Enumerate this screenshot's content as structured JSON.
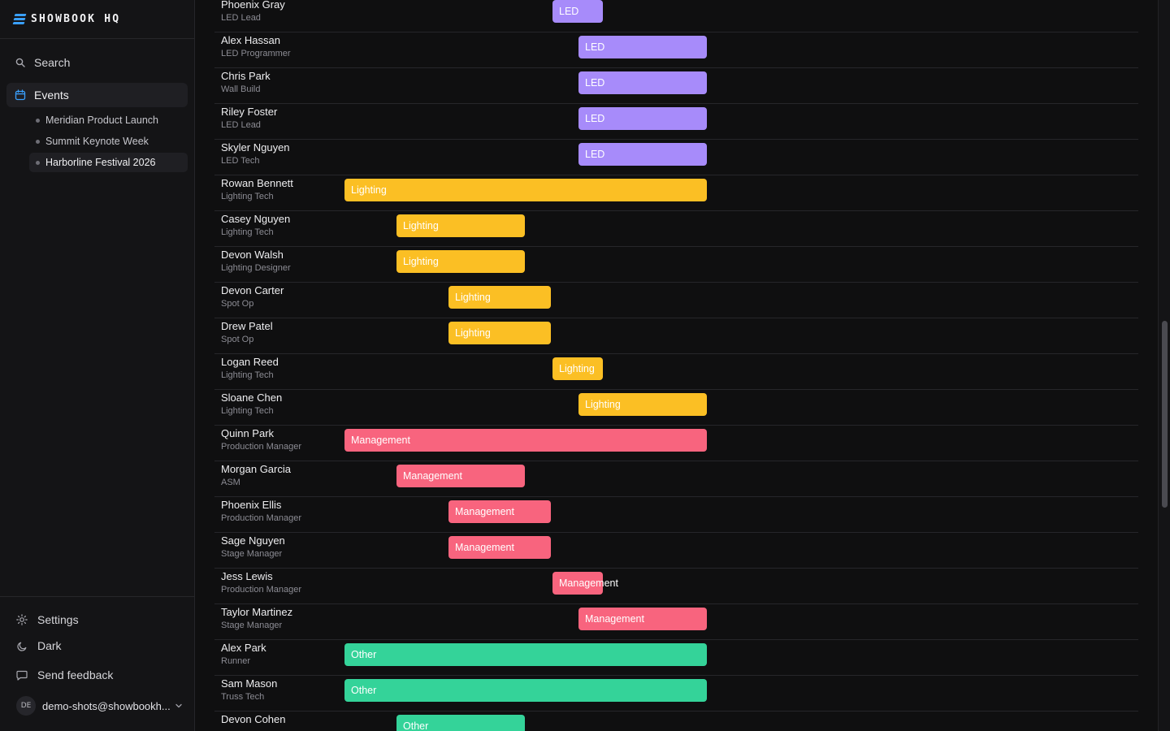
{
  "brand": {
    "name": "SHOWBOOK HQ"
  },
  "nav": {
    "search_label": "Search",
    "events_label": "Events",
    "events": [
      {
        "label": "Meridian Product Launch"
      },
      {
        "label": "Summit Keynote Week"
      },
      {
        "label": "Harborline Festival 2026"
      }
    ]
  },
  "bottom": {
    "settings_label": "Settings",
    "dark_label": "Dark",
    "feedback_label": "Send feedback",
    "user_initials": "DE",
    "user_email": "demo-shots@showbookh..."
  },
  "colors": {
    "LED": "#a78bfa",
    "Lighting": "#fbbf24",
    "Management": "#f8647e",
    "Other": "#34d399",
    "accent": "#3aa0ff"
  },
  "crew": [
    {
      "name": "Phoenix Gray",
      "role": "LED Lead",
      "dept": "LED",
      "start": 8,
      "span": 2
    },
    {
      "name": "Alex Hassan",
      "role": "LED Programmer",
      "dept": "LED",
      "start": 9,
      "span": 5
    },
    {
      "name": "Chris Park",
      "role": "Wall Build",
      "dept": "LED",
      "start": 9,
      "span": 5
    },
    {
      "name": "Riley Foster",
      "role": "LED Lead",
      "dept": "LED",
      "start": 9,
      "span": 5
    },
    {
      "name": "Skyler Nguyen",
      "role": "LED Tech",
      "dept": "LED",
      "start": 9,
      "span": 5
    },
    {
      "name": "Rowan Bennett",
      "role": "Lighting Tech",
      "dept": "Lighting",
      "start": 0,
      "span": 14
    },
    {
      "name": "Casey Nguyen",
      "role": "Lighting Tech",
      "dept": "Lighting",
      "start": 2,
      "span": 5
    },
    {
      "name": "Devon Walsh",
      "role": "Lighting Designer",
      "dept": "Lighting",
      "start": 2,
      "span": 5
    },
    {
      "name": "Devon Carter",
      "role": "Spot Op",
      "dept": "Lighting",
      "start": 4,
      "span": 4
    },
    {
      "name": "Drew Patel",
      "role": "Spot Op",
      "dept": "Lighting",
      "start": 4,
      "span": 4
    },
    {
      "name": "Logan Reed",
      "role": "Lighting Tech",
      "dept": "Lighting",
      "start": 8,
      "span": 2
    },
    {
      "name": "Sloane Chen",
      "role": "Lighting Tech",
      "dept": "Lighting",
      "start": 9,
      "span": 5
    },
    {
      "name": "Quinn Park",
      "role": "Production Manager",
      "dept": "Management",
      "start": 0,
      "span": 14
    },
    {
      "name": "Morgan Garcia",
      "role": "ASM",
      "dept": "Management",
      "start": 2,
      "span": 5
    },
    {
      "name": "Phoenix Ellis",
      "role": "Production Manager",
      "dept": "Management",
      "start": 4,
      "span": 4
    },
    {
      "name": "Sage Nguyen",
      "role": "Stage Manager",
      "dept": "Management",
      "start": 4,
      "span": 4
    },
    {
      "name": "Jess Lewis",
      "role": "Production Manager",
      "dept": "Management",
      "start": 8,
      "span": 2
    },
    {
      "name": "Taylor Martinez",
      "role": "Stage Manager",
      "dept": "Management",
      "start": 9,
      "span": 5
    },
    {
      "name": "Alex Park",
      "role": "Runner",
      "dept": "Other",
      "start": 0,
      "span": 14
    },
    {
      "name": "Sam Mason",
      "role": "Truss Tech",
      "dept": "Other",
      "start": 0,
      "span": 14
    },
    {
      "name": "Devon Cohen",
      "role": "",
      "dept": "Other",
      "start": 2,
      "span": 5
    }
  ]
}
